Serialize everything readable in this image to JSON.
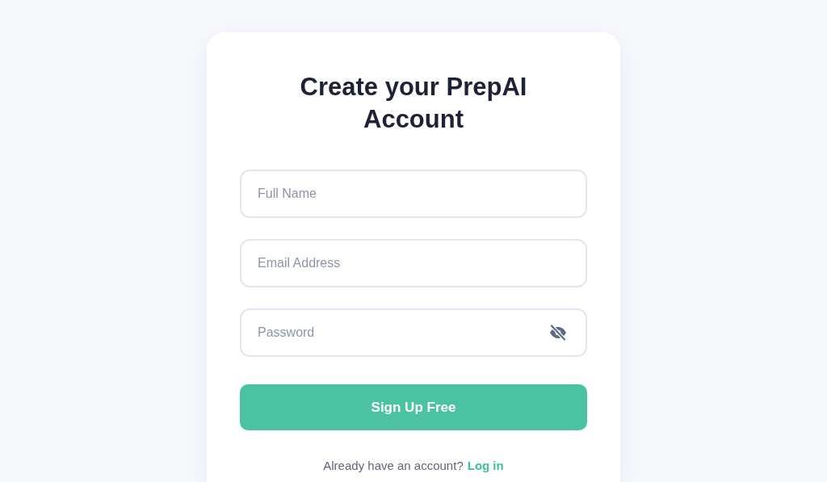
{
  "title": "Create your PrepAI Account",
  "fields": [
    {
      "placeholder": "Full Name",
      "kind": "text"
    },
    {
      "placeholder": "Email Address",
      "kind": "email"
    },
    {
      "placeholder": "Password",
      "kind": "password"
    }
  ],
  "submit_button": "Sign Up Free",
  "login_prompt": {
    "text": "Already have an account?",
    "link": "Log in"
  }
}
